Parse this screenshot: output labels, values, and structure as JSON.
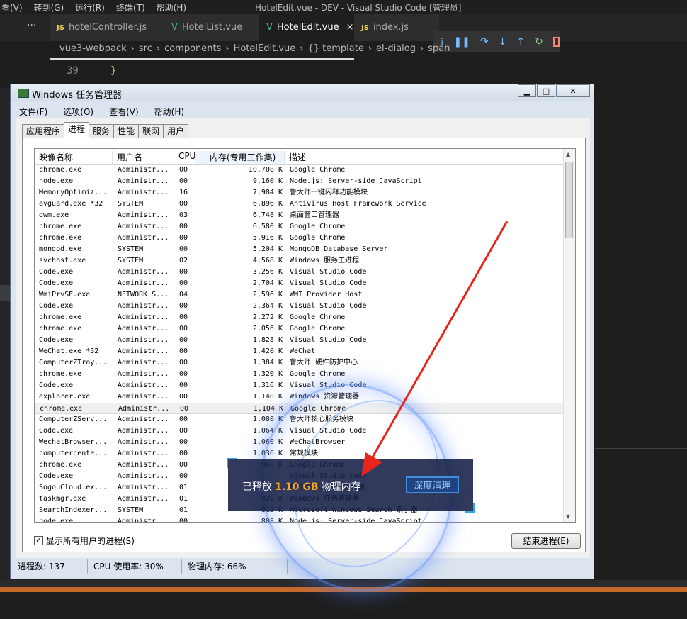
{
  "vscode": {
    "menu": [
      "看(V)",
      "转到(G)",
      "运行(R)",
      "终端(T)",
      "帮助(H)"
    ],
    "window_title": "HotelEdit.vue - DEV - Visual Studio Code [管理员]",
    "ellipsis": "···",
    "tabs": [
      {
        "label": "hotelController.js",
        "kind": "JS"
      },
      {
        "label": "HotelList.vue",
        "kind": "V"
      },
      {
        "label": "HotelEdit.vue",
        "kind": "V"
      },
      {
        "label": "index.js",
        "kind": "JS"
      }
    ],
    "close_glyph": "×",
    "breadcrumb": [
      "vue3-webpack",
      "src",
      "components",
      "HotelEdit.vue",
      "{} template",
      "el-dialog",
      "span"
    ],
    "line_number": "39",
    "code_line": "}"
  },
  "taskmgr": {
    "title": "Windows 任务管理器",
    "window_buttons": {
      "minimize": "▁",
      "maximize": "□",
      "close": "✕"
    },
    "menu": [
      "文件(F)",
      "选项(O)",
      "查看(V)",
      "帮助(H)"
    ],
    "tabs": [
      "应用程序",
      "进程",
      "服务",
      "性能",
      "联网",
      "用户"
    ],
    "active_tab": "进程",
    "columns": [
      "映像名称",
      "用户名",
      "CPU",
      "内存(专用工作集)",
      "描述"
    ],
    "processes": [
      [
        "chrome.exe",
        "Administr...",
        "00",
        "10,708 K",
        "Google Chrome"
      ],
      [
        "node.exe",
        "Administr...",
        "00",
        "9,160 K",
        "Node.js: Server-side JavaScript"
      ],
      [
        "MemoryOptimiz...",
        "Administr...",
        "16",
        "7,984 K",
        "鲁大师一键闪释功能模块"
      ],
      [
        "avguard.exe *32",
        "SYSTEM",
        "00",
        "6,896 K",
        "Antivirus Host Framework Service"
      ],
      [
        "dwm.exe",
        "Administr...",
        "03",
        "6,748 K",
        "桌面窗口管理器"
      ],
      [
        "chrome.exe",
        "Administr...",
        "00",
        "6,580 K",
        "Google Chrome"
      ],
      [
        "chrome.exe",
        "Administr...",
        "00",
        "5,916 K",
        "Google Chrome"
      ],
      [
        "mongod.exe",
        "SYSTEM",
        "00",
        "5,204 K",
        "MongoDB Database Server"
      ],
      [
        "svchost.exe",
        "SYSTEM",
        "02",
        "4,568 K",
        "Windows 服务主进程"
      ],
      [
        "Code.exe",
        "Administr...",
        "00",
        "3,256 K",
        "Visual Studio Code"
      ],
      [
        "Code.exe",
        "Administr...",
        "00",
        "2,704 K",
        "Visual Studio Code"
      ],
      [
        "WmiPrvSE.exe",
        "NETWORK S...",
        "04",
        "2,596 K",
        "WMI Provider Host"
      ],
      [
        "Code.exe",
        "Administr...",
        "00",
        "2,364 K",
        "Visual Studio Code"
      ],
      [
        "chrome.exe",
        "Administr...",
        "00",
        "2,272 K",
        "Google Chrome"
      ],
      [
        "chrome.exe",
        "Administr...",
        "00",
        "2,056 K",
        "Google Chrome"
      ],
      [
        "Code.exe",
        "Administr...",
        "00",
        "1,828 K",
        "Visual Studio Code"
      ],
      [
        "WeChat.exe *32",
        "Administr...",
        "00",
        "1,420 K",
        "WeChat"
      ],
      [
        "ComputerZTray...",
        "Administr...",
        "00",
        "1,384 K",
        "鲁大师 硬件防护中心"
      ],
      [
        "chrome.exe",
        "Administr...",
        "00",
        "1,320 K",
        "Google Chrome"
      ],
      [
        "Code.exe",
        "Administr...",
        "00",
        "1,316 K",
        "Visual Studio Code"
      ],
      [
        "explorer.exe",
        "Administr...",
        "00",
        "1,140 K",
        "Windows 资源管理器"
      ],
      [
        "chrome.exe",
        "Administr...",
        "00",
        "1,104 K",
        "Google Chrome"
      ],
      [
        "ComputerZServ...",
        "Administr...",
        "00",
        "1,080 K",
        "鲁大师核心服务模块"
      ],
      [
        "Code.exe",
        "Administr...",
        "00",
        "1,064 K",
        "Visual Studio Code"
      ],
      [
        "WechatBrowser...",
        "Administr...",
        "00",
        "1,060 K",
        "WeChatBrowser"
      ],
      [
        "computercente...",
        "Administr...",
        "00",
        "1,036 K",
        "常规模块"
      ],
      [
        "chrome.exe",
        "Administr...",
        "00",
        "960 K",
        "Google Chrome"
      ],
      [
        "Code.exe",
        "Administr...",
        "00",
        "",
        "Visual Studio Code"
      ],
      [
        "SogouCloud.ex...",
        "Administr...",
        "01",
        "",
        "搜狗输入法 云计算代理"
      ],
      [
        "taskmgr.exe",
        "Administr...",
        "01",
        "920 K",
        "Windows 任务管理器"
      ],
      [
        "SearchIndexer...",
        "SYSTEM",
        "01",
        "812 K",
        "Microsoft Windows Search 索引器"
      ],
      [
        "node.exe",
        "Administr...",
        "00",
        "808 K",
        "Node.js: Server-side JavaScript"
      ]
    ],
    "selected_row": 21,
    "show_all_label": "显示所有用户的进程(S)",
    "show_all_checked": "✓",
    "end_process_label": "结束进程(E)",
    "status": {
      "processes": "进程数: 137",
      "cpu": "CPU 使用率: 30%",
      "memory": "物理内存: 66%"
    }
  },
  "toast": {
    "prefix": "已释放",
    "amount": "1.10 GB",
    "suffix": "物理内存",
    "button": "深度清理"
  },
  "colors": {
    "accent_red": "#e8251b",
    "toast_orange": "#f6a623",
    "vscode_bg": "#1e1e1e"
  }
}
